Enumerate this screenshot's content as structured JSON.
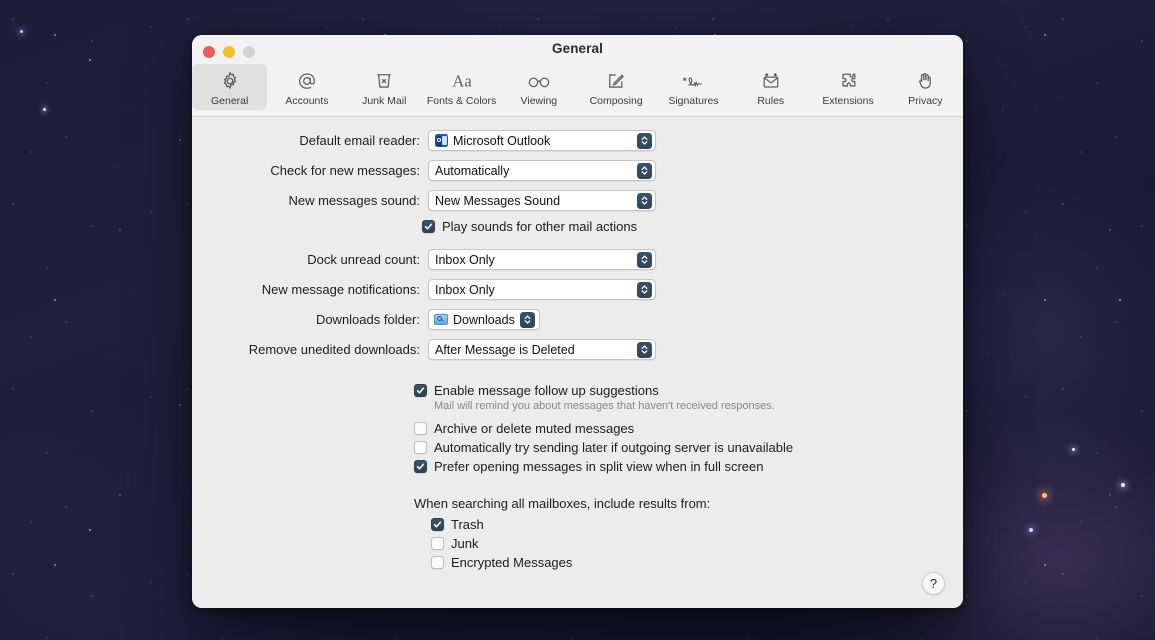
{
  "window": {
    "title": "General",
    "traffic_lights": [
      {
        "name": "close",
        "color": "#f05b52"
      },
      {
        "name": "minimize",
        "color": "#f6bd31"
      },
      {
        "name": "zoom",
        "color": "#d3d3d3"
      }
    ]
  },
  "toolbar": {
    "selected": "General",
    "items": [
      {
        "label": "General",
        "icon": "gear-icon"
      },
      {
        "label": "Accounts",
        "icon": "at-sign-icon"
      },
      {
        "label": "Junk Mail",
        "icon": "trash-x-icon"
      },
      {
        "label": "Fonts & Colors",
        "icon": "aa-text-icon"
      },
      {
        "label": "Viewing",
        "icon": "glasses-icon"
      },
      {
        "label": "Composing",
        "icon": "pencil-square-icon"
      },
      {
        "label": "Signatures",
        "icon": "signature-icon"
      },
      {
        "label": "Rules",
        "icon": "envelope-rules-icon"
      },
      {
        "label": "Extensions",
        "icon": "puzzle-piece-icon"
      },
      {
        "label": "Privacy",
        "icon": "hand-icon"
      }
    ]
  },
  "settings": {
    "popup_rows": [
      {
        "label": "Default email reader:",
        "value": "Microsoft Outlook",
        "icon": "outlook-app-icon"
      },
      {
        "label": "Check for new messages:",
        "value": "Automatically",
        "icon": null
      },
      {
        "label": "New messages sound:",
        "value": "New Messages Sound",
        "icon": null
      }
    ],
    "sound_checkbox": {
      "label": "Play sounds for other mail actions",
      "checked": true
    },
    "popup_rows2": [
      {
        "label": "Dock unread count:",
        "value": "Inbox Only",
        "icon": null
      },
      {
        "label": "New message notifications:",
        "value": "Inbox Only",
        "icon": null
      }
    ],
    "downloads_row": {
      "label": "Downloads folder:",
      "value": "Downloads",
      "icon": "downloads-folder-icon"
    },
    "remove_row": {
      "label": "Remove unedited downloads:",
      "value": "After Message is Deleted",
      "icon": null
    },
    "checkboxes": [
      {
        "label": "Enable message follow up suggestions",
        "checked": true,
        "hint": "Mail will remind you about messages that haven't received responses."
      },
      {
        "label": "Archive or delete muted messages",
        "checked": false,
        "hint": null
      },
      {
        "label": "Automatically try sending later if outgoing server is unavailable",
        "checked": false,
        "hint": null
      },
      {
        "label": "Prefer opening messages in split view when in full screen",
        "checked": true,
        "hint": null
      }
    ],
    "search_section": {
      "heading": "When searching all mailboxes, include results from:",
      "options": [
        {
          "label": "Trash",
          "checked": true
        },
        {
          "label": "Junk",
          "checked": false
        },
        {
          "label": "Encrypted Messages",
          "checked": false
        }
      ]
    }
  },
  "help_button": {
    "label": "?"
  },
  "colors": {
    "accent": "#3c5368",
    "window_bg": "#ececec",
    "toolbar_bg": "#f2f2f2",
    "field_bg": "#ffffff",
    "hint_text": "#878787"
  }
}
